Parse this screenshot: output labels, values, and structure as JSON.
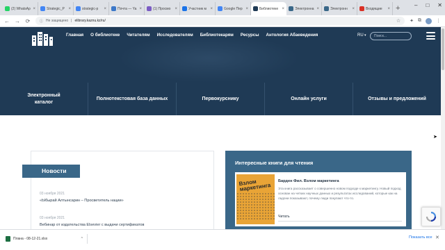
{
  "browser": {
    "tabs": [
      {
        "title": "(2) WhatsAp",
        "color": "#25d366",
        "active": false
      },
      {
        "title": "Strategic_P",
        "color": "#4285f4",
        "active": false
      },
      {
        "title": "strategic-p",
        "color": "#4285f4",
        "active": false
      },
      {
        "title": "Почта — Ya",
        "color": "#3c78c8",
        "active": false
      },
      {
        "title": "(1) Просмо",
        "color": "#7b5cc4",
        "active": false
      },
      {
        "title": "Участник м",
        "color": "#1a73e8",
        "active": false
      },
      {
        "title": "Google Пер",
        "color": "#4285f4",
        "active": false
      },
      {
        "title": "Библиотеке",
        "color": "#1f3a55",
        "active": true
      },
      {
        "title": "Электронна",
        "color": "#3a6788",
        "active": false
      },
      {
        "title": "Электронн",
        "color": "#3a6788",
        "active": false
      },
      {
        "title": "Входящие",
        "color": "#d93025",
        "active": false
      }
    ],
    "new_tab": "+",
    "window_controls": {
      "minimize": "–",
      "maximize": "□",
      "close": "✕"
    },
    "nav": {
      "back": "←",
      "forward": "→",
      "reload": "⟳"
    },
    "address": {
      "security": "Не защищено",
      "url": "elibrary.kaznu.kz/ru/"
    }
  },
  "site": {
    "topnav": [
      "Главная",
      "О библиотеке",
      "Читателям",
      "Исследователям",
      "Библиотекарям",
      "Ресурсы",
      "Антология Абаеведения"
    ],
    "lang": "RU",
    "search_placeholder": "Поиск...",
    "categories": [
      {
        "line1": "Электронный",
        "line2": "каталог"
      },
      {
        "line1": "Полнотекстовая база данных",
        "line2": ""
      },
      {
        "line1": "Первокурснику",
        "line2": ""
      },
      {
        "line1": "Онлайн услуги",
        "line2": ""
      },
      {
        "line1": "Отзывы и предложений",
        "line2": ""
      }
    ],
    "colors": {
      "header": "#1f3a55",
      "accent": "#3a6788"
    }
  },
  "news": {
    "title": "Новости",
    "items": [
      {
        "date": "03 ноября 2021",
        "text": "«Ыбырай Алтынсарин – Просветитель нации»"
      },
      {
        "date": "03 ноября 2021",
        "text": "Вебинар от издательства Elsevier с выдачи сертификатов"
      }
    ]
  },
  "books": {
    "title": "Интересные книги для чтения",
    "cover_title": "Взлом маркетинга",
    "name": "Барден Фил. Взлом маркетинга",
    "description": "Эта книга рассказывает о совершенно новом подходе к маркетингу. Новый подход основан на четких научных данных и результатах исследований, которые как на ладони показывают, почему люди покупают что-то.",
    "read": "Читать"
  },
  "downloads": {
    "file": "Плана - 08-12-21.xlsx",
    "show_all": "Показать все",
    "close": "✕"
  }
}
